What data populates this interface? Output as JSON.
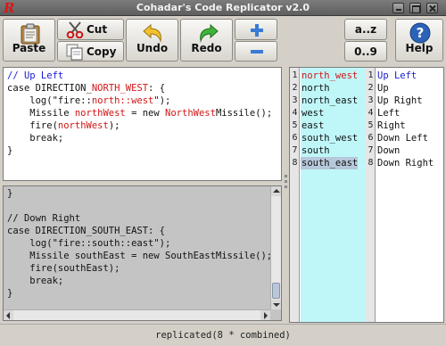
{
  "window": {
    "title": "Cohadar's Code Replicator v2.0",
    "app_icon_letter": "R"
  },
  "toolbar": {
    "paste": "Paste",
    "cut": "Cut",
    "copy": "Copy",
    "undo": "Undo",
    "redo": "Redo",
    "plus": "+",
    "minus": "−",
    "sort_alpha": "a..z",
    "sort_num": "0..9",
    "help": "Help"
  },
  "colors": {
    "accent_blue": "#1a1ad0",
    "highlight_red": "#d21414",
    "list_a_bg": "#bff7f9",
    "selection": "#b6c8da"
  },
  "template_lines": [
    [
      {
        "t": "// Up Left",
        "c": "comment"
      }
    ],
    [
      {
        "t": "case DIRECTION_"
      },
      {
        "t": "NORTH_WEST",
        "c": "red"
      },
      {
        "t": ": {"
      }
    ],
    [
      {
        "t": "    log(\"fire::"
      },
      {
        "t": "north::west",
        "c": "red"
      },
      {
        "t": "\");"
      }
    ],
    [
      {
        "t": "    Missile "
      },
      {
        "t": "northWest",
        "c": "red"
      },
      {
        "t": " = new "
      },
      {
        "t": "NorthWest",
        "c": "red"
      },
      {
        "t": "Missile();"
      }
    ],
    [
      {
        "t": "    fire("
      },
      {
        "t": "northWest",
        "c": "red"
      },
      {
        "t": ");"
      }
    ],
    [
      {
        "t": "    break;"
      }
    ],
    [
      {
        "t": "}"
      }
    ]
  ],
  "preview_lines": [
    "}",
    "",
    "// Down Right",
    "case DIRECTION_SOUTH_EAST: {",
    "    log(\"fire::south::east\");",
    "    Missile southEast = new SouthEastMissile();",
    "    fire(southEast);",
    "    break;",
    "}"
  ],
  "list_a": {
    "numbers": [
      "1",
      "2",
      "3",
      "4",
      "5",
      "6",
      "7",
      "8"
    ],
    "items": [
      "north_west",
      "north",
      "north_east",
      "west",
      "east",
      "south_west",
      "south",
      "south_east"
    ],
    "first_red": true,
    "selected_index": 7
  },
  "list_b": {
    "items": [
      "Up Left",
      "Up",
      "Up Right",
      "Left",
      "Right",
      "Down Left",
      "Down",
      "Down Right"
    ],
    "first_blue": true
  },
  "status": {
    "text": "replicated(8 * combined)"
  }
}
